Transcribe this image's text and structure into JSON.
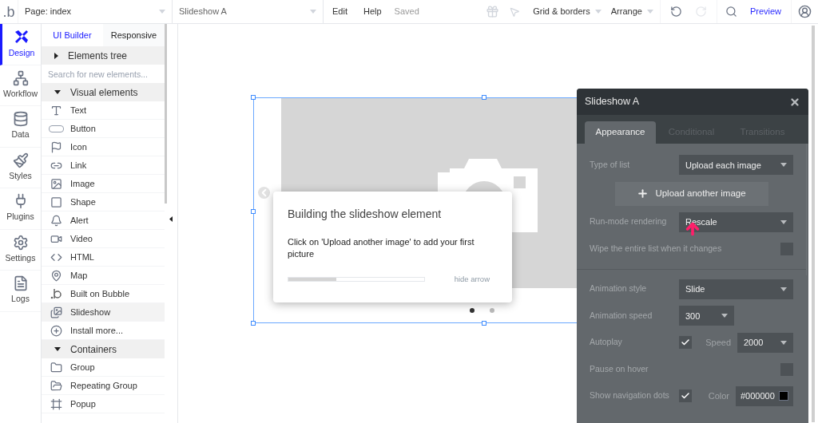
{
  "topbar": {
    "logo": ".b",
    "page_select": "Page: index",
    "element_select": "Slideshow A",
    "menu": [
      "Edit",
      "Help"
    ],
    "saved": "Saved",
    "grid_menu": "Grid & borders",
    "arrange_menu": "Arrange",
    "preview": "Preview"
  },
  "nav": [
    {
      "label": "Design",
      "selected": true
    },
    {
      "label": "Workflow",
      "selected": false
    },
    {
      "label": "Data",
      "selected": false
    },
    {
      "label": "Styles",
      "selected": false
    },
    {
      "label": "Plugins",
      "selected": false
    },
    {
      "label": "Settings",
      "selected": false
    },
    {
      "label": "Logs",
      "selected": false
    }
  ],
  "panel_tabs": [
    {
      "label": "UI Builder",
      "selected": true
    },
    {
      "label": "Responsive",
      "selected": false
    }
  ],
  "tree_header": {
    "label": "Elements tree",
    "expanded": false
  },
  "search": {
    "placeholder": "Search for new elements..."
  },
  "sections": [
    {
      "label": "Visual elements",
      "expanded": true,
      "items": [
        {
          "label": "Text",
          "selected": false
        },
        {
          "label": "Button",
          "selected": false
        },
        {
          "label": "Icon",
          "selected": false
        },
        {
          "label": "Link",
          "selected": false
        },
        {
          "label": "Image",
          "selected": false
        },
        {
          "label": "Shape",
          "selected": false
        },
        {
          "label": "Alert",
          "selected": false
        },
        {
          "label": "Video",
          "selected": false
        },
        {
          "label": "HTML",
          "selected": false
        },
        {
          "label": "Map",
          "selected": false
        },
        {
          "label": "Built on Bubble",
          "selected": false
        },
        {
          "label": "Slideshow",
          "selected": true
        },
        {
          "label": "Install more...",
          "selected": false
        }
      ]
    },
    {
      "label": "Containers",
      "expanded": true,
      "items": [
        {
          "label": "Group",
          "selected": false
        },
        {
          "label": "Repeating Group",
          "selected": false
        },
        {
          "label": "Popup",
          "selected": false
        }
      ]
    }
  ],
  "canvas": {
    "slideshow": {
      "dots": [
        {
          "selected": true
        },
        {
          "selected": false
        }
      ]
    },
    "tooltip": {
      "title": "Building the slideshow element",
      "body": "Click on 'Upload another image' to add your first picture",
      "level": 0.35,
      "hide_link": "hide arrow"
    }
  },
  "property_editor": {
    "title": "Slideshow A",
    "tabs": [
      {
        "label": "Appearance",
        "selected": true
      },
      {
        "label": "Conditional",
        "selected": false
      },
      {
        "label": "Transitions",
        "selected": false
      }
    ],
    "rows": [
      {
        "kind": "dropdown",
        "label": "Type of list",
        "value": "Upload each image"
      },
      {
        "kind": "button",
        "label": "Upload another image"
      },
      {
        "kind": "dropdown",
        "label": "Run-mode rendering",
        "value": "Rescale"
      },
      {
        "kind": "checkbox",
        "label": "Wipe the entire list when it changes",
        "checked": false
      },
      {
        "kind": "divider"
      },
      {
        "kind": "dropdown",
        "label": "Animation style",
        "value": "Slide"
      },
      {
        "kind": "small-dropdown",
        "label": "Animation speed",
        "value": "300"
      },
      {
        "kind": "checkbox",
        "label": "Autoplay",
        "checked": true,
        "extra": {
          "kind": "dropdown",
          "label": "Speed",
          "value": "2000"
        }
      },
      {
        "kind": "checkbox",
        "label": "Pause on hover",
        "checked": false
      },
      {
        "kind": "checkbox",
        "label": "Show navigation dots",
        "checked": true,
        "extra": {
          "kind": "color",
          "label": "Color",
          "value": "#000000",
          "color": "#000000"
        }
      }
    ]
  }
}
